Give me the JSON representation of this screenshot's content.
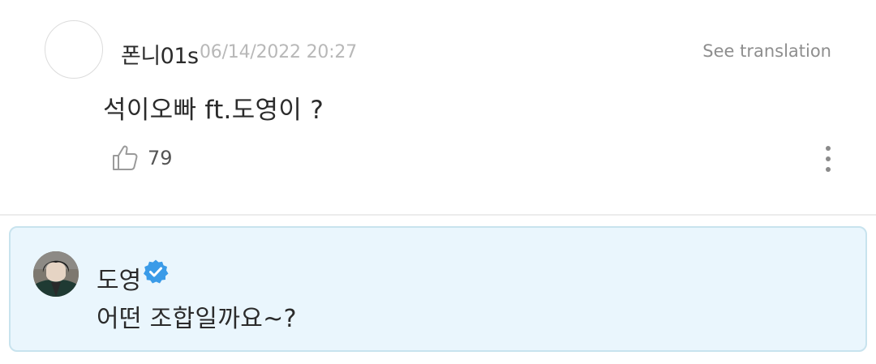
{
  "comment": {
    "username": "폰니01s",
    "timestamp": "06/14/2022 20:27",
    "see_translation_label": "See translation",
    "text": "석이오빠 ft.도영이 ?",
    "like_count": "79"
  },
  "reply": {
    "author": "도영",
    "verified": true,
    "text": "어떤 조합일까요~?"
  },
  "icons": {
    "like": "thumbs-up-icon",
    "more": "more-vertical-icon",
    "verified": "verified-check-icon"
  },
  "colors": {
    "reply_background": "#eaf6fd",
    "reply_border": "#c8e3ee",
    "verified_blue": "#3a9be8",
    "timestamp_gray": "#b8b8b8"
  }
}
